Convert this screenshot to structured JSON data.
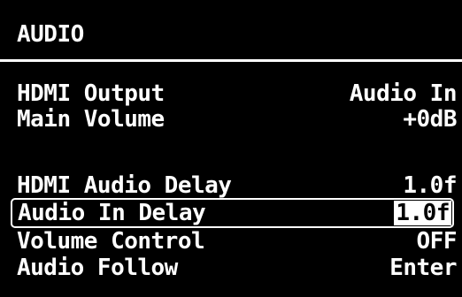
{
  "menu": {
    "title": "AUDIO",
    "items": [
      {
        "label": "HDMI Output",
        "value": "Audio In"
      },
      {
        "label": "Main Volume",
        "value": "+0dB"
      },
      {
        "label": "HDMI Audio Delay",
        "value": "1.0f"
      },
      {
        "label": "Audio In Delay",
        "value": "1.0f"
      },
      {
        "label": "Volume Control",
        "value": "OFF"
      },
      {
        "label": "Audio Follow",
        "value": "Enter"
      }
    ],
    "selected_index": 3
  },
  "colors": {
    "background": "#000000",
    "foreground": "#ffffff"
  }
}
